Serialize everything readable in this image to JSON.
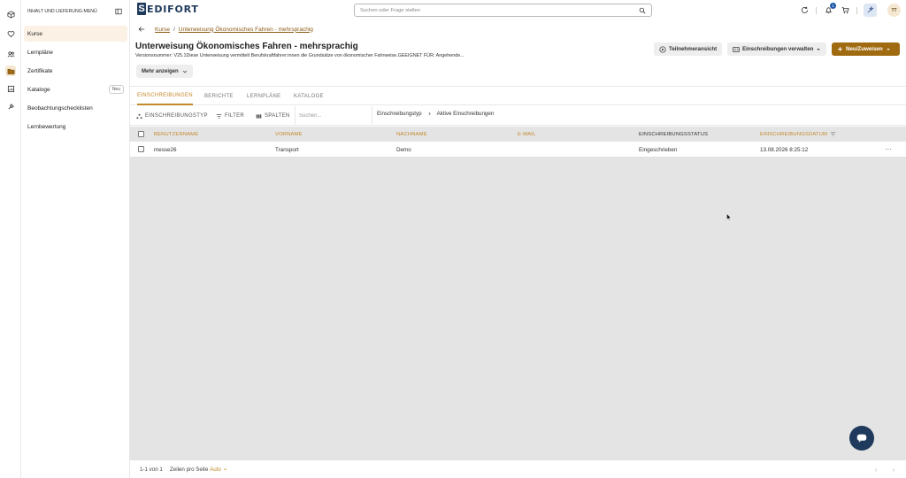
{
  "sidemenu": {
    "title": "INHALT UND LIEFERUNG-MENÜ",
    "items": [
      {
        "label": "Kurse",
        "badge": ""
      },
      {
        "label": "Lernpläne",
        "badge": ""
      },
      {
        "label": "Zertifikate",
        "badge": ""
      },
      {
        "label": "Kataloge",
        "badge": "Neu"
      },
      {
        "label": "Beobachtungschecklisten",
        "badge": ""
      },
      {
        "label": "Lernbewertung",
        "badge": ""
      }
    ]
  },
  "rail": {
    "icons": [
      "cube-icon",
      "heart-icon",
      "users-icon",
      "folder-icon",
      "report-icon",
      "tools-icon"
    ]
  },
  "topbar": {
    "logo_text": "EDIFORT",
    "logo_mark": "S",
    "search_placeholder": "Suchen oder Frage stellen",
    "notification_count": "1",
    "avatar_initials": "TT"
  },
  "breadcrumb": {
    "items": [
      "Kurse",
      "Unterweisung Ökonomisches Fahren - mehrsprachig"
    ],
    "separator": "/"
  },
  "header": {
    "title": "Unterweisung Ökonomisches Fahren - mehrsprachig",
    "description": "Versionsnummer: V25.1Diese Unterweisung vermittelt Berufskraftfahrer:innen die Grundsätze von ökonomischer Fahrweise.GEEIGNET FÜR: Angehende...",
    "more_label": "Mehr anzeigen",
    "btn_participant_view": "Teilnehmeransicht",
    "btn_manage_enrollments": "Einschreibungen verwalten",
    "btn_new_assign": "Neu/Zuweisen"
  },
  "tabs": [
    "EINSCHREIBUNGEN",
    "BERICHTE",
    "LERNPLÄNE",
    "KATALOGE"
  ],
  "toolbar": {
    "enrollment_type": "EINSCHREIBUNGSTYP",
    "filter": "FILTER",
    "columns": "SPALTEN",
    "search_placeholder": "Suchen...",
    "filter_key": "Einschreibungstyp",
    "filter_value": "Aktive Einschreibungen"
  },
  "table": {
    "columns": [
      "BENUTZERNAME",
      "VORNAME",
      "NACHNAME",
      "E-MAIL",
      "EINSCHREIBUNGSSTATUS",
      "EINSCHREIBUNGSDATUM"
    ],
    "rows": [
      [
        "messe26",
        "Transport",
        "Demo",
        "",
        "Eingeschrieben",
        "13.08.2026 8:25:12"
      ]
    ]
  },
  "footer": {
    "range": "1-1 von 1",
    "rows_per_page_label": "Zeilen pro Seite",
    "rows_per_page_value": "Auto"
  },
  "colors": {
    "accent": "#c4872a",
    "primary_button": "#a06a10",
    "brand_navy": "#1f3a5c"
  }
}
